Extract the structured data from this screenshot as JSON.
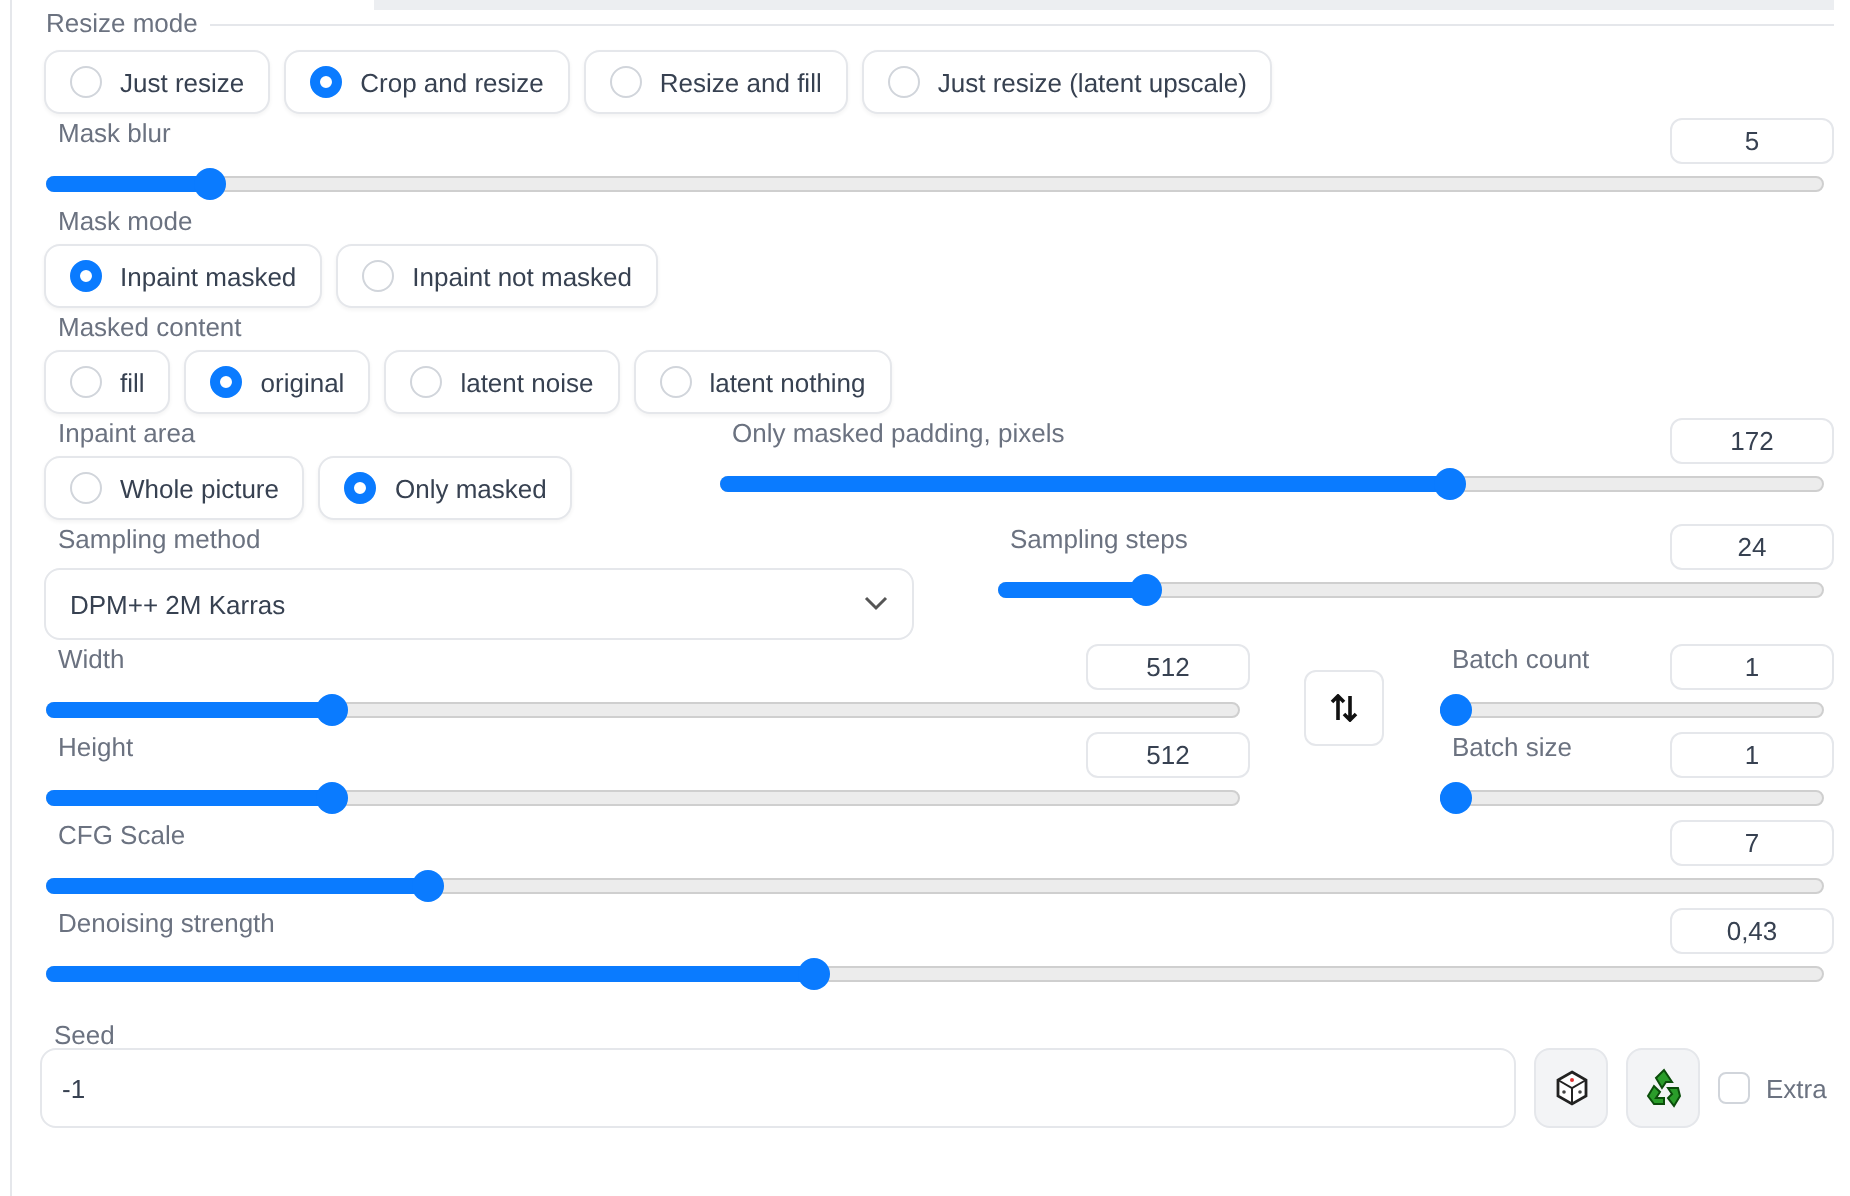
{
  "resize_mode": {
    "label": "Resize mode",
    "options": [
      {
        "label": "Just resize",
        "selected": false
      },
      {
        "label": "Crop and resize",
        "selected": true
      },
      {
        "label": "Resize and fill",
        "selected": false
      },
      {
        "label": "Just resize (latent upscale)",
        "selected": false
      }
    ]
  },
  "mask_blur": {
    "label": "Mask blur",
    "value": "5",
    "level": 0.085
  },
  "mask_mode": {
    "label": "Mask mode",
    "options": [
      {
        "label": "Inpaint masked",
        "selected": true
      },
      {
        "label": "Inpaint not masked",
        "selected": false
      }
    ]
  },
  "masked_content": {
    "label": "Masked content",
    "options": [
      {
        "label": "fill",
        "selected": false
      },
      {
        "label": "original",
        "selected": true
      },
      {
        "label": "latent noise",
        "selected": false
      },
      {
        "label": "latent nothing",
        "selected": false
      }
    ]
  },
  "inpaint_area": {
    "label": "Inpaint area",
    "options": [
      {
        "label": "Whole picture",
        "selected": false
      },
      {
        "label": "Only masked",
        "selected": true
      }
    ]
  },
  "only_masked_padding": {
    "label": "Only masked padding, pixels",
    "value": "172",
    "level": 0.666
  },
  "sampling_method": {
    "label": "Sampling method",
    "value": "DPM++ 2M Karras"
  },
  "sampling_steps": {
    "label": "Sampling steps",
    "value": "24",
    "level": 0.166
  },
  "width": {
    "label": "Width",
    "value": "512",
    "level": 0.232
  },
  "height": {
    "label": "Height",
    "value": "512",
    "level": 0.232
  },
  "batch_count": {
    "label": "Batch count",
    "value": "1",
    "level": 0
  },
  "batch_size": {
    "label": "Batch size",
    "value": "1",
    "level": 0
  },
  "cfg_scale": {
    "label": "CFG Scale",
    "value": "7",
    "level": 0.21
  },
  "denoising_strength": {
    "label": "Denoising strength",
    "value": "0,43",
    "level": 0.431
  },
  "seed": {
    "label": "Seed",
    "value": "-1"
  },
  "extra": {
    "label": "Extra",
    "checked": false
  }
}
